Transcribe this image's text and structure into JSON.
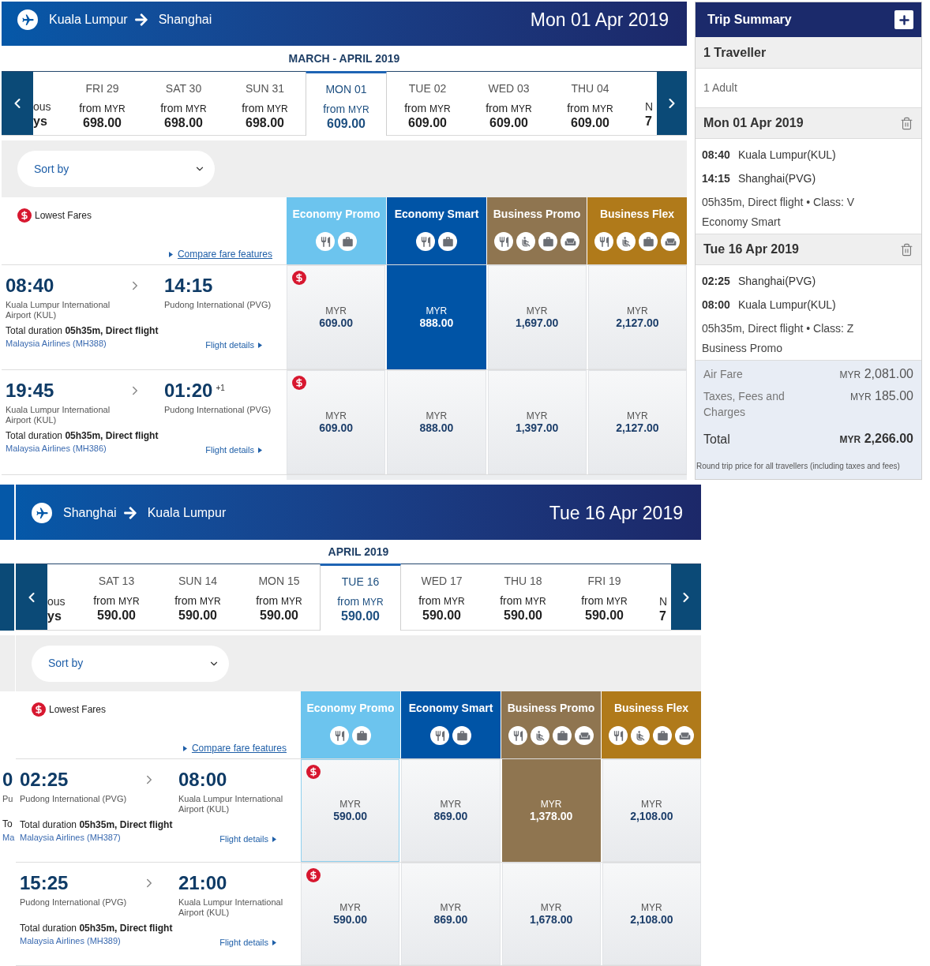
{
  "sections": [
    {
      "route": {
        "origin": "Kuala Lumpur",
        "destination": "Shanghai"
      },
      "date": "Mon 01 Apr 2019",
      "month_label": "MARCH - APRIL 2019",
      "prev_fragment": [
        "ous",
        "ys"
      ],
      "next_fragment": [
        "N",
        "7"
      ],
      "days": [
        {
          "day": "FRI 29",
          "from": "from",
          "currency": "MYR",
          "price": "698.00",
          "selected": false
        },
        {
          "day": "SAT 30",
          "from": "from",
          "currency": "MYR",
          "price": "698.00",
          "selected": false
        },
        {
          "day": "SUN 31",
          "from": "from",
          "currency": "MYR",
          "price": "698.00",
          "selected": false
        },
        {
          "day": "MON 01",
          "from": "from",
          "currency": "MYR",
          "price": "609.00",
          "selected": true
        },
        {
          "day": "TUE 02",
          "from": "from",
          "currency": "MYR",
          "price": "609.00",
          "selected": false
        },
        {
          "day": "WED 03",
          "from": "from",
          "currency": "MYR",
          "price": "609.00",
          "selected": false
        },
        {
          "day": "THU 04",
          "from": "from",
          "currency": "MYR",
          "price": "609.00",
          "selected": false
        }
      ],
      "sort": {
        "label": "Sort by"
      },
      "legend": "Lowest Fares",
      "compare_link": "Compare fare features",
      "fare_types": [
        {
          "name": "Economy Promo",
          "color": "#6cc4ee",
          "amenities": [
            {
              "kind": "meal"
            },
            {
              "kind": "baggage"
            }
          ]
        },
        {
          "name": "Economy Smart",
          "color": "#0054a6",
          "amenities": [
            {
              "kind": "meal"
            },
            {
              "kind": "baggage"
            }
          ]
        },
        {
          "name": "Business Promo",
          "color": "#8f7550",
          "amenities": [
            {
              "kind": "meal"
            },
            {
              "kind": "seat"
            },
            {
              "kind": "baggage"
            },
            {
              "kind": "lounge"
            }
          ]
        },
        {
          "name": "Business Flex",
          "color": "#b07a1a",
          "amenities": [
            {
              "kind": "meal"
            },
            {
              "kind": "seat"
            },
            {
              "kind": "baggage"
            },
            {
              "kind": "lounge"
            }
          ]
        }
      ],
      "flights": [
        {
          "departure": {
            "time": "08:40",
            "airport": "Kuala Lumpur International Airport (KUL)"
          },
          "arrival": {
            "time": "14:15",
            "airport": "Pudong International (PVG)"
          },
          "duration": "Total duration **05h35m, Direct flight**",
          "airline": "Malaysia Airlines (MH388)",
          "details_link": "Flight details",
          "fares": [
            {
              "currency": "MYR",
              "price": "609.00",
              "lowest": true,
              "selected": false,
              "outlined": false
            },
            {
              "currency": "MYR",
              "price": "888.00",
              "lowest": false,
              "selected": true,
              "outlined": false
            },
            {
              "currency": "MYR",
              "price": "1,697.00",
              "lowest": false,
              "selected": false,
              "outlined": false
            },
            {
              "currency": "MYR",
              "price": "2,127.00",
              "lowest": false,
              "selected": false,
              "outlined": false
            }
          ]
        },
        {
          "departure": {
            "time": "19:45",
            "airport": "Kuala Lumpur International Airport (KUL)"
          },
          "arrival": {
            "time": "01:20",
            "day_offset": "+1",
            "airport": "Pudong International (PVG)"
          },
          "duration": "Total duration **05h35m, Direct flight**",
          "airline": "Malaysia Airlines (MH386)",
          "details_link": "Flight details",
          "fares": [
            {
              "currency": "MYR",
              "price": "609.00",
              "lowest": true,
              "selected": false,
              "outlined": false
            },
            {
              "currency": "MYR",
              "price": "888.00",
              "lowest": false,
              "selected": false,
              "outlined": false
            },
            {
              "currency": "MYR",
              "price": "1,397.00",
              "lowest": false,
              "selected": false,
              "outlined": false
            },
            {
              "currency": "MYR",
              "price": "2,127.00",
              "lowest": false,
              "selected": false,
              "outlined": false
            }
          ]
        }
      ]
    },
    {
      "route": {
        "origin": "Shanghai",
        "destination": "Kuala Lumpur"
      },
      "date": "Tue 16 Apr 2019",
      "month_label": "APRIL 2019",
      "prev_fragment": [
        "ous",
        "ys"
      ],
      "next_fragment": [
        "N",
        "7"
      ],
      "days": [
        {
          "day": "SAT 13",
          "from": "from",
          "currency": "MYR",
          "price": "590.00",
          "selected": false
        },
        {
          "day": "SUN 14",
          "from": "from",
          "currency": "MYR",
          "price": "590.00",
          "selected": false
        },
        {
          "day": "MON 15",
          "from": "from",
          "currency": "MYR",
          "price": "590.00",
          "selected": false
        },
        {
          "day": "TUE 16",
          "from": "from",
          "currency": "MYR",
          "price": "590.00",
          "selected": true
        },
        {
          "day": "WED 17",
          "from": "from",
          "currency": "MYR",
          "price": "590.00",
          "selected": false
        },
        {
          "day": "THU 18",
          "from": "from",
          "currency": "MYR",
          "price": "590.00",
          "selected": false
        },
        {
          "day": "FRI 19",
          "from": "from",
          "currency": "MYR",
          "price": "590.00",
          "selected": false
        }
      ],
      "sort": {
        "label": "Sort by"
      },
      "legend": "Lowest Fares",
      "compare_link": "Compare fare features",
      "fare_types": [
        {
          "name": "Economy Promo",
          "color": "#6cc4ee",
          "amenities": [
            {
              "kind": "meal"
            },
            {
              "kind": "baggage"
            }
          ]
        },
        {
          "name": "Economy Smart",
          "color": "#0054a6",
          "amenities": [
            {
              "kind": "meal"
            },
            {
              "kind": "baggage"
            }
          ]
        },
        {
          "name": "Business Promo",
          "color": "#8f7550",
          "amenities": [
            {
              "kind": "meal"
            },
            {
              "kind": "seat"
            },
            {
              "kind": "baggage"
            },
            {
              "kind": "lounge"
            }
          ]
        },
        {
          "name": "Business Flex",
          "color": "#b07a1a",
          "amenities": [
            {
              "kind": "meal"
            },
            {
              "kind": "seat"
            },
            {
              "kind": "baggage"
            },
            {
              "kind": "lounge"
            }
          ]
        }
      ],
      "flights": [
        {
          "departure": {
            "time": "02:25",
            "airport": "Pudong International (PVG)"
          },
          "arrival": {
            "time": "08:00",
            "airport": "Kuala Lumpur International Airport (KUL)"
          },
          "duration": "Total duration **05h35m, Direct flight**",
          "airline": "Malaysia Airlines (MH387)",
          "details_link": "Flight details",
          "fares": [
            {
              "currency": "MYR",
              "price": "590.00",
              "lowest": true,
              "selected": false,
              "outlined": true
            },
            {
              "currency": "MYR",
              "price": "869.00",
              "lowest": false,
              "selected": false,
              "outlined": false
            },
            {
              "currency": "MYR",
              "price": "1,378.00",
              "lowest": false,
              "selected": true,
              "outlined": false
            },
            {
              "currency": "MYR",
              "price": "2,108.00",
              "lowest": false,
              "selected": false,
              "outlined": false
            }
          ]
        },
        {
          "departure": {
            "time": "15:25",
            "airport": "Pudong International (PVG)"
          },
          "arrival": {
            "time": "21:00",
            "airport": "Kuala Lumpur International Airport (KUL)"
          },
          "duration": "Total duration **05h35m, Direct flight**",
          "airline": "Malaysia Airlines (MH389)",
          "details_link": "Flight details",
          "fares": [
            {
              "currency": "MYR",
              "price": "590.00",
              "lowest": true,
              "selected": false,
              "outlined": false
            },
            {
              "currency": "MYR",
              "price": "869.00",
              "lowest": false,
              "selected": false,
              "outlined": false
            },
            {
              "currency": "MYR",
              "price": "1,678.00",
              "lowest": false,
              "selected": false,
              "outlined": false
            },
            {
              "currency": "MYR",
              "price": "2,108.00",
              "lowest": false,
              "selected": false,
              "outlined": false
            }
          ]
        }
      ],
      "edge_fragments": [
        {
          "time": "0",
          "airport": "Pu",
          "duration": "To",
          "airline": "Ma"
        }
      ]
    }
  ],
  "trip_summary": {
    "title": "Trip Summary",
    "travellers": {
      "heading": "1 Traveller",
      "detail": "1 Adult"
    },
    "legs": [
      {
        "date": "Mon 01 Apr 2019",
        "stops": [
          {
            "time": "08:40",
            "place": "Kuala Lumpur(KUL)"
          },
          {
            "time": "14:15",
            "place": "Shanghai(PVG)"
          }
        ],
        "info": "05h35m, Direct flight • Class: V",
        "fare": "Economy Smart"
      },
      {
        "date": "Tue 16 Apr 2019",
        "stops": [
          {
            "time": "02:25",
            "place": "Shanghai(PVG)"
          },
          {
            "time": "08:00",
            "place": "Kuala Lumpur(KUL)"
          }
        ],
        "info": "05h35m, Direct flight • Class: Z",
        "fare": "Business Promo"
      }
    ],
    "prices": [
      {
        "label": "Air Fare",
        "currency": "MYR",
        "amount": "2,081.00"
      },
      {
        "label": "Taxes, Fees and Charges",
        "currency": "MYR",
        "amount": "185.00"
      }
    ],
    "total": {
      "label": "Total",
      "currency": "MYR",
      "amount": "2,266.00"
    },
    "note": "Round trip price for all travellers (including taxes and fees)"
  }
}
